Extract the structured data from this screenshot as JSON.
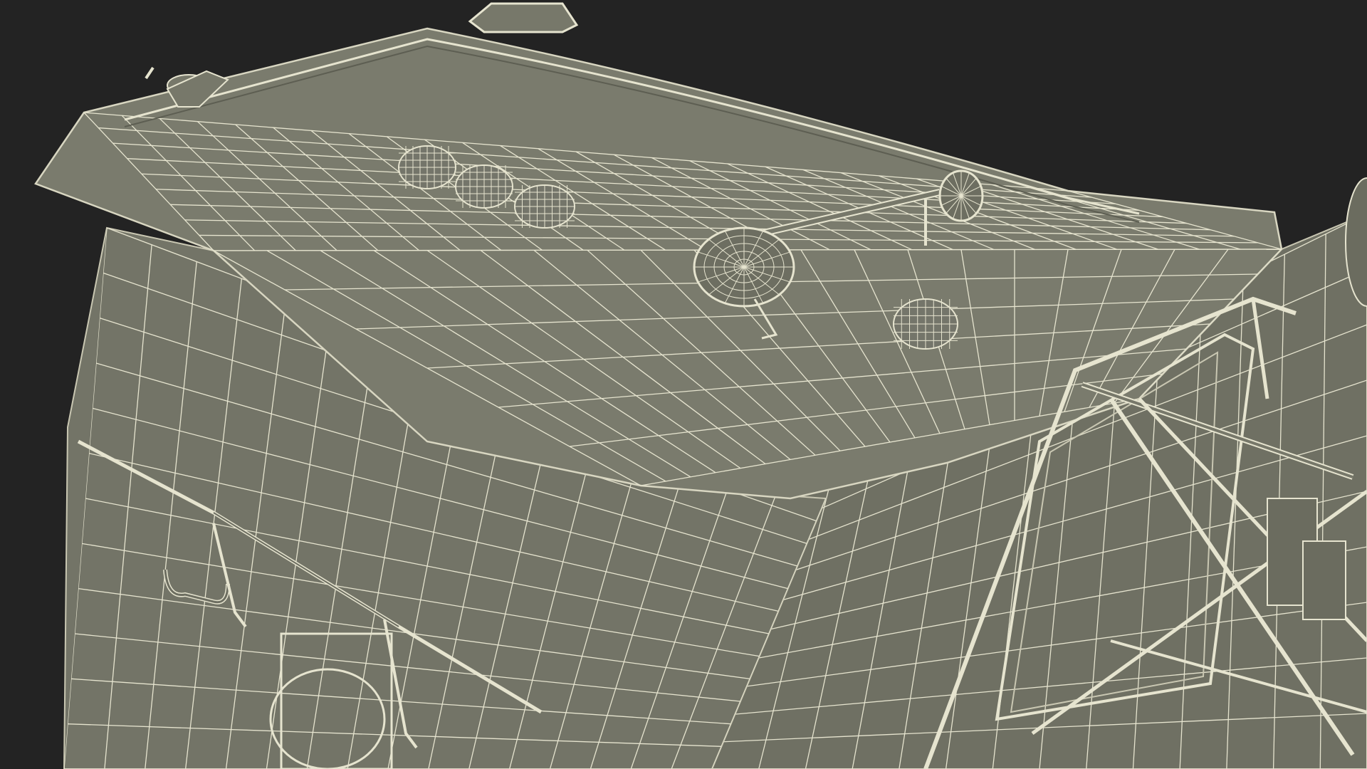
{
  "scene": {
    "subject": "truck-cab-wireframe",
    "colors": {
      "background": "#232323",
      "surface": "#77786a",
      "surface_dark": "#6a6b5e",
      "surface_light": "#85867a",
      "wire": "#e6e4cf",
      "edge": "#c9c7b2"
    },
    "objects": [
      {
        "name": "roof-panel"
      },
      {
        "name": "rear-wall"
      },
      {
        "name": "side-wall"
      },
      {
        "name": "air-horn"
      },
      {
        "name": "marker-light-cluster"
      },
      {
        "name": "roof-antenna"
      },
      {
        "name": "door-handle"
      },
      {
        "name": "windshield-wiper"
      },
      {
        "name": "side-window-frame"
      }
    ]
  }
}
